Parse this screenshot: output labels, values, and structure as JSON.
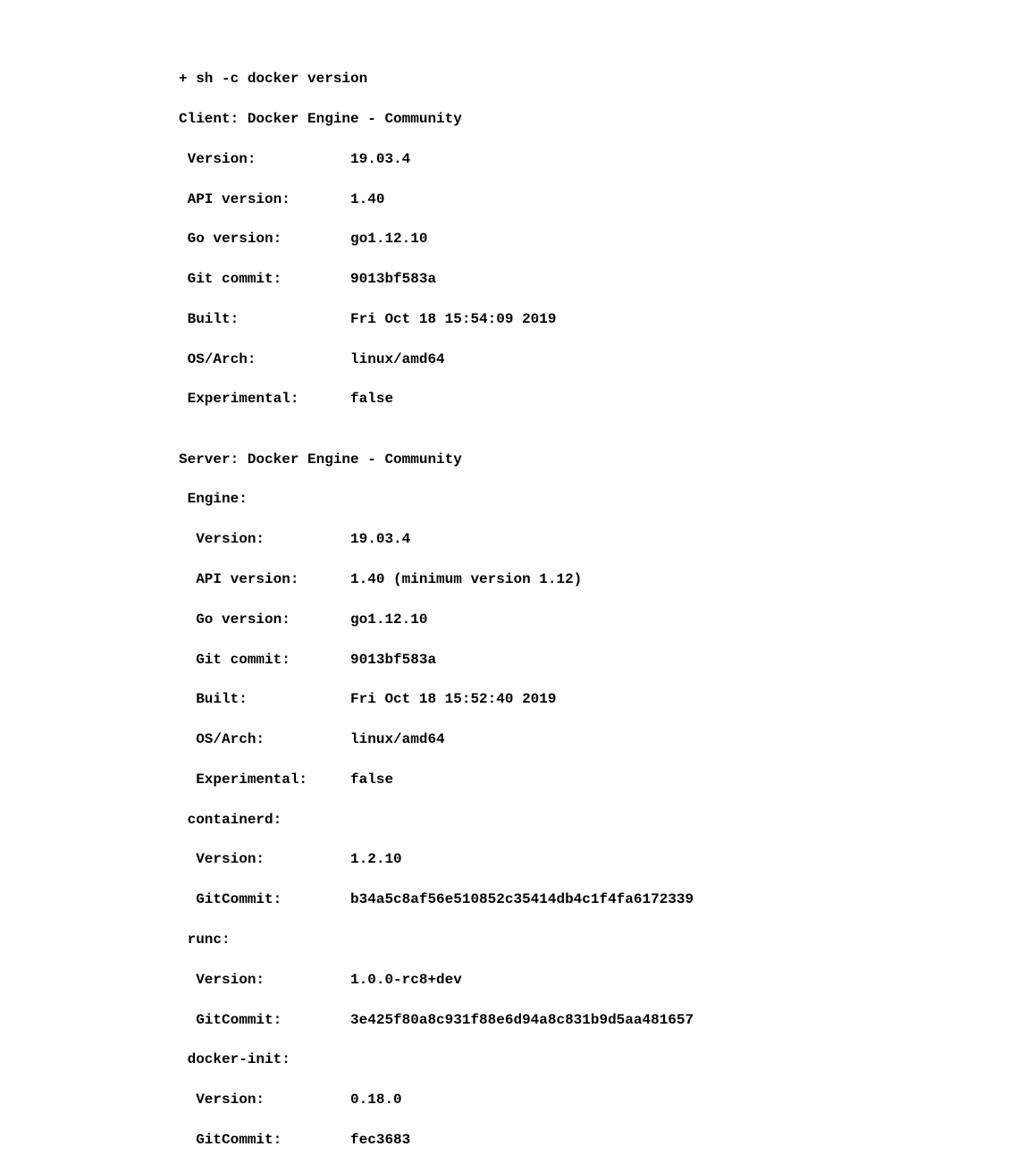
{
  "command": "+ sh -c docker version",
  "client_header": "Client: Docker Engine - Community",
  "client": {
    "version_label": " Version:           ",
    "version": "19.03.4",
    "api_label": " API version:       ",
    "api": "1.40",
    "go_label": " Go version:        ",
    "go": "go1.12.10",
    "git_label": " Git commit:        ",
    "git": "9013bf583a",
    "built_label": " Built:             ",
    "built": "Fri Oct 18 15:54:09 2019",
    "os_label": " OS/Arch:           ",
    "os": "linux/amd64",
    "exp_label": " Experimental:      ",
    "exp": "false"
  },
  "blank": "",
  "server_header": "Server: Docker Engine - Community",
  "engine_header": " Engine:",
  "engine": {
    "version_label": "  Version:          ",
    "version": "19.03.4",
    "api_label": "  API version:      ",
    "api": "1.40 (minimum version 1.12)",
    "go_label": "  Go version:       ",
    "go": "go1.12.10",
    "git_label": "  Git commit:       ",
    "git": "9013bf583a",
    "built_label": "  Built:            ",
    "built": "Fri Oct 18 15:52:40 2019",
    "os_label": "  OS/Arch:          ",
    "os": "linux/amd64",
    "exp_label": "  Experimental:     ",
    "exp": "false"
  },
  "containerd_header": " containerd:",
  "containerd": {
    "version_label": "  Version:          ",
    "version": "1.2.10",
    "git_label": "  GitCommit:        ",
    "git": "b34a5c8af56e510852c35414db4c1f4fa6172339"
  },
  "runc_header": " runc:",
  "runc": {
    "version_label": "  Version:          ",
    "version": "1.0.0-rc8+dev",
    "git_label": "  GitCommit:        ",
    "git": "3e425f80a8c931f88e6d94a8c831b9d5aa481657"
  },
  "dockerinit_header": " docker-init:",
  "dockerinit": {
    "version_label": "  Version:          ",
    "version": "0.18.0",
    "git_label": "  GitCommit:        ",
    "git": "fec3683"
  }
}
